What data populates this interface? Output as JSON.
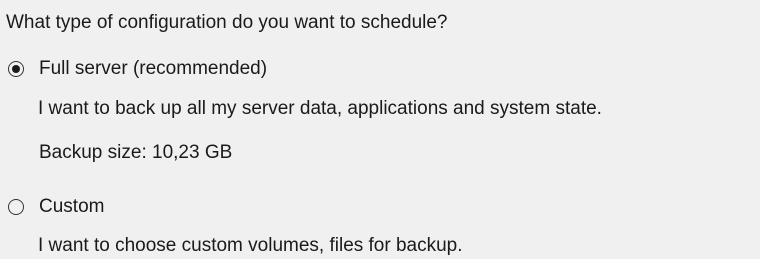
{
  "question": "What type of configuration do you want to schedule?",
  "options": [
    {
      "label": "Full server (recommended)",
      "selected": true,
      "description": "I want to back up all my server data, applications and system state.",
      "backup_size": "Backup size: 10,23 GB"
    },
    {
      "label": "Custom",
      "selected": false,
      "description": "I want to choose custom volumes, files for backup."
    }
  ]
}
